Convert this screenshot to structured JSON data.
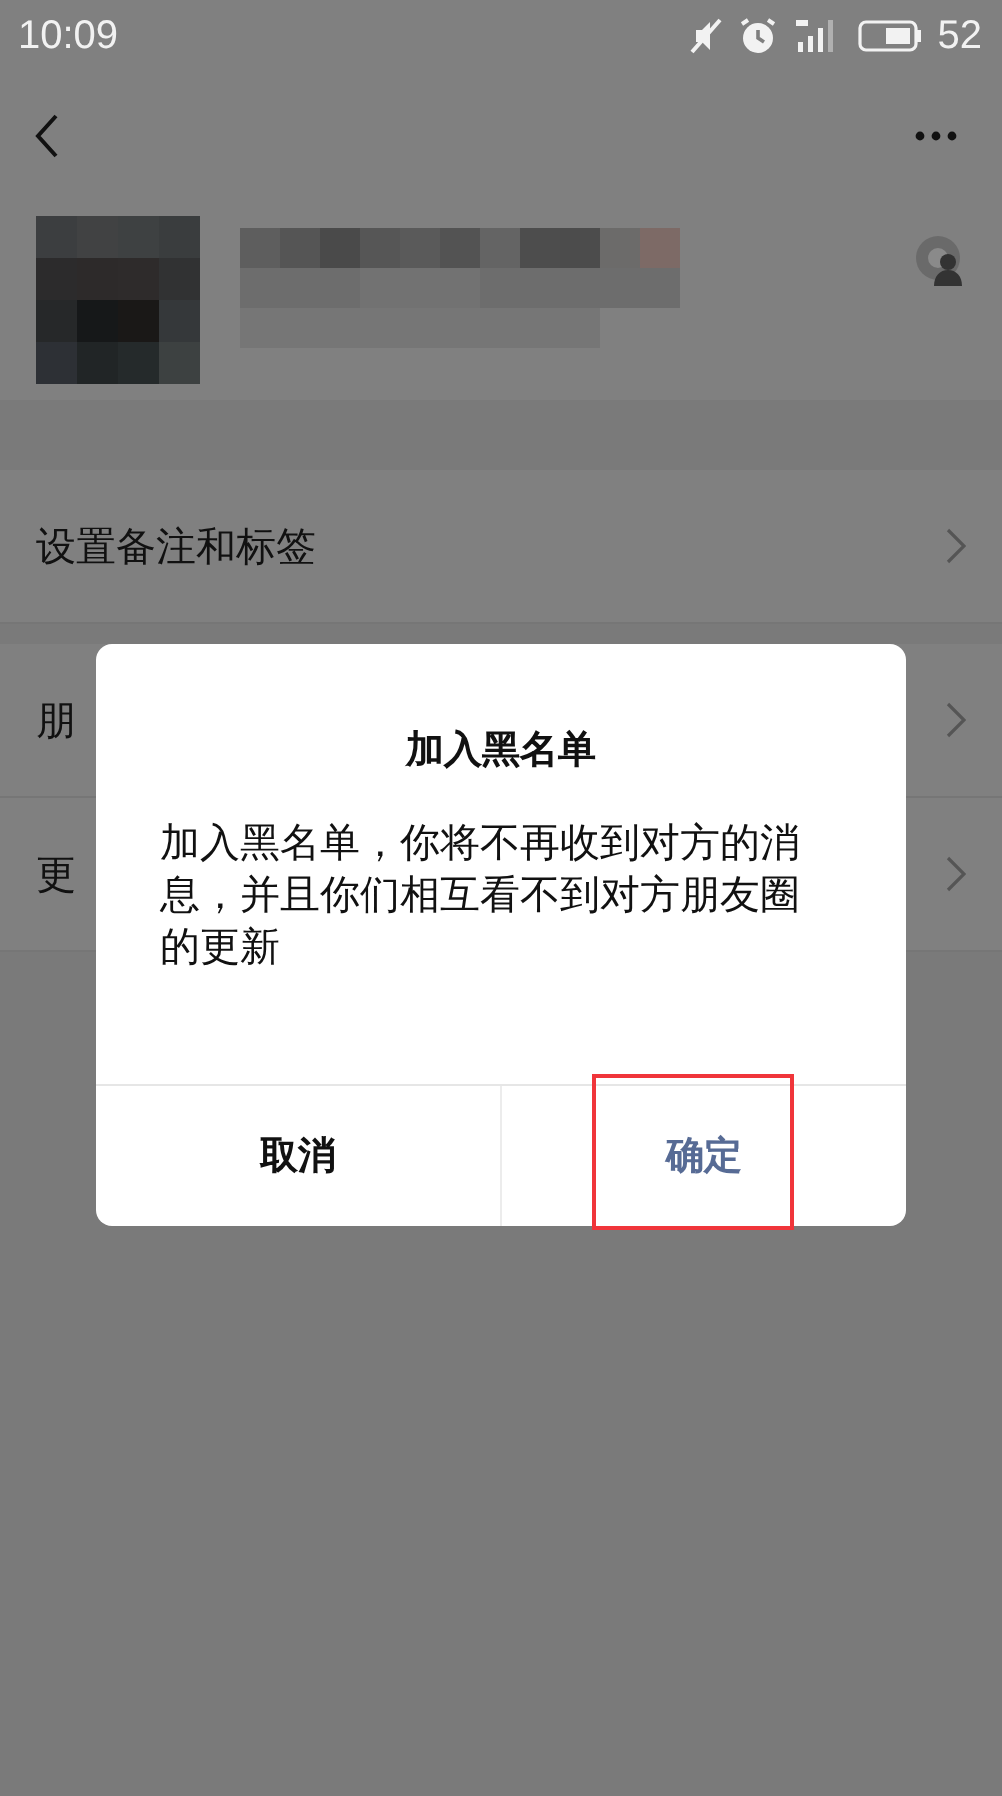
{
  "status_bar": {
    "time": "10:09",
    "battery": "52"
  },
  "menu_rows": [
    {
      "label": "设置备注和标签"
    },
    {
      "label": "朋"
    },
    {
      "label": "更"
    }
  ],
  "dialog": {
    "title": "加入黑名单",
    "message": "加入黑名单，你将不再收到对方的消息，并且你们相互看不到对方朋友圈的更新",
    "buttons": [
      {
        "label": "取消",
        "kind": "cancel",
        "highlighted": false
      },
      {
        "label": "确定",
        "kind": "confirm",
        "highlighted": true
      }
    ]
  }
}
